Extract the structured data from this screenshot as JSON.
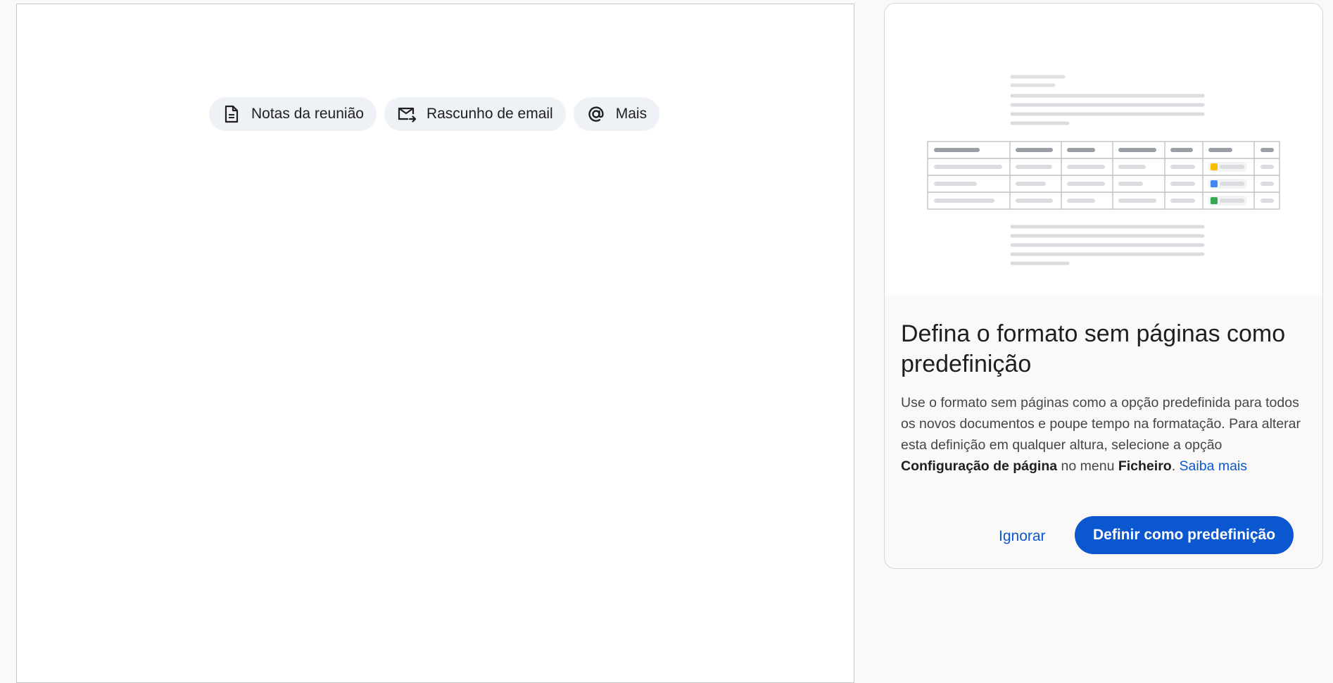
{
  "chips": [
    {
      "label": "Notas da reunião",
      "icon": "document-icon"
    },
    {
      "label": "Rascunho de email",
      "icon": "email-draft-icon"
    },
    {
      "label": "Mais",
      "icon": "at-sign-icon"
    }
  ],
  "card": {
    "title": "Defina o formato sem páginas como predefinição",
    "body_part1": "Use o formato sem páginas como a opção predefinida para todos os novos documentos e poupe tempo na formatação. Para alterar esta definição em qualquer altura, selecione a opção ",
    "body_bold1": "Configuração de página",
    "body_part2": " no menu ",
    "body_bold2": "Ficheiro",
    "body_part3": ". ",
    "learn_more": "Saiba mais",
    "dismiss_label": "Ignorar",
    "confirm_label": "Definir como predefinição"
  },
  "colors": {
    "accent": "#0b57d0",
    "chip_bg": "#eef1f5",
    "tag_yellow": "#fbbc04",
    "tag_blue": "#4285f4",
    "tag_green": "#34a853"
  }
}
